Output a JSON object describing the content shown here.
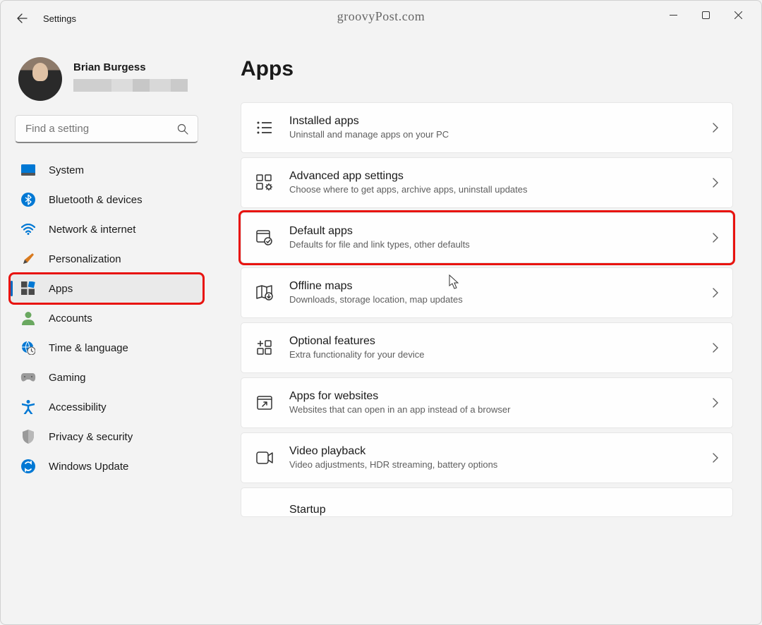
{
  "app_title": "Settings",
  "watermark": "groovyPost.com",
  "user": {
    "name": "Brian Burgess"
  },
  "search": {
    "placeholder": "Find a setting"
  },
  "sidebar": {
    "items": [
      {
        "label": "System"
      },
      {
        "label": "Bluetooth & devices"
      },
      {
        "label": "Network & internet"
      },
      {
        "label": "Personalization"
      },
      {
        "label": "Apps"
      },
      {
        "label": "Accounts"
      },
      {
        "label": "Time & language"
      },
      {
        "label": "Gaming"
      },
      {
        "label": "Accessibility"
      },
      {
        "label": "Privacy & security"
      },
      {
        "label": "Windows Update"
      }
    ]
  },
  "page": {
    "title": "Apps"
  },
  "cards": [
    {
      "title": "Installed apps",
      "desc": "Uninstall and manage apps on your PC"
    },
    {
      "title": "Advanced app settings",
      "desc": "Choose where to get apps, archive apps, uninstall updates"
    },
    {
      "title": "Default apps",
      "desc": "Defaults for file and link types, other defaults"
    },
    {
      "title": "Offline maps",
      "desc": "Downloads, storage location, map updates"
    },
    {
      "title": "Optional features",
      "desc": "Extra functionality for your device"
    },
    {
      "title": "Apps for websites",
      "desc": "Websites that can open in an app instead of a browser"
    },
    {
      "title": "Video playback",
      "desc": "Video adjustments, HDR streaming, battery options"
    },
    {
      "title": "Startup",
      "desc": ""
    }
  ],
  "colors": {
    "accent": "#0067c0",
    "highlight": "#e8130f"
  }
}
